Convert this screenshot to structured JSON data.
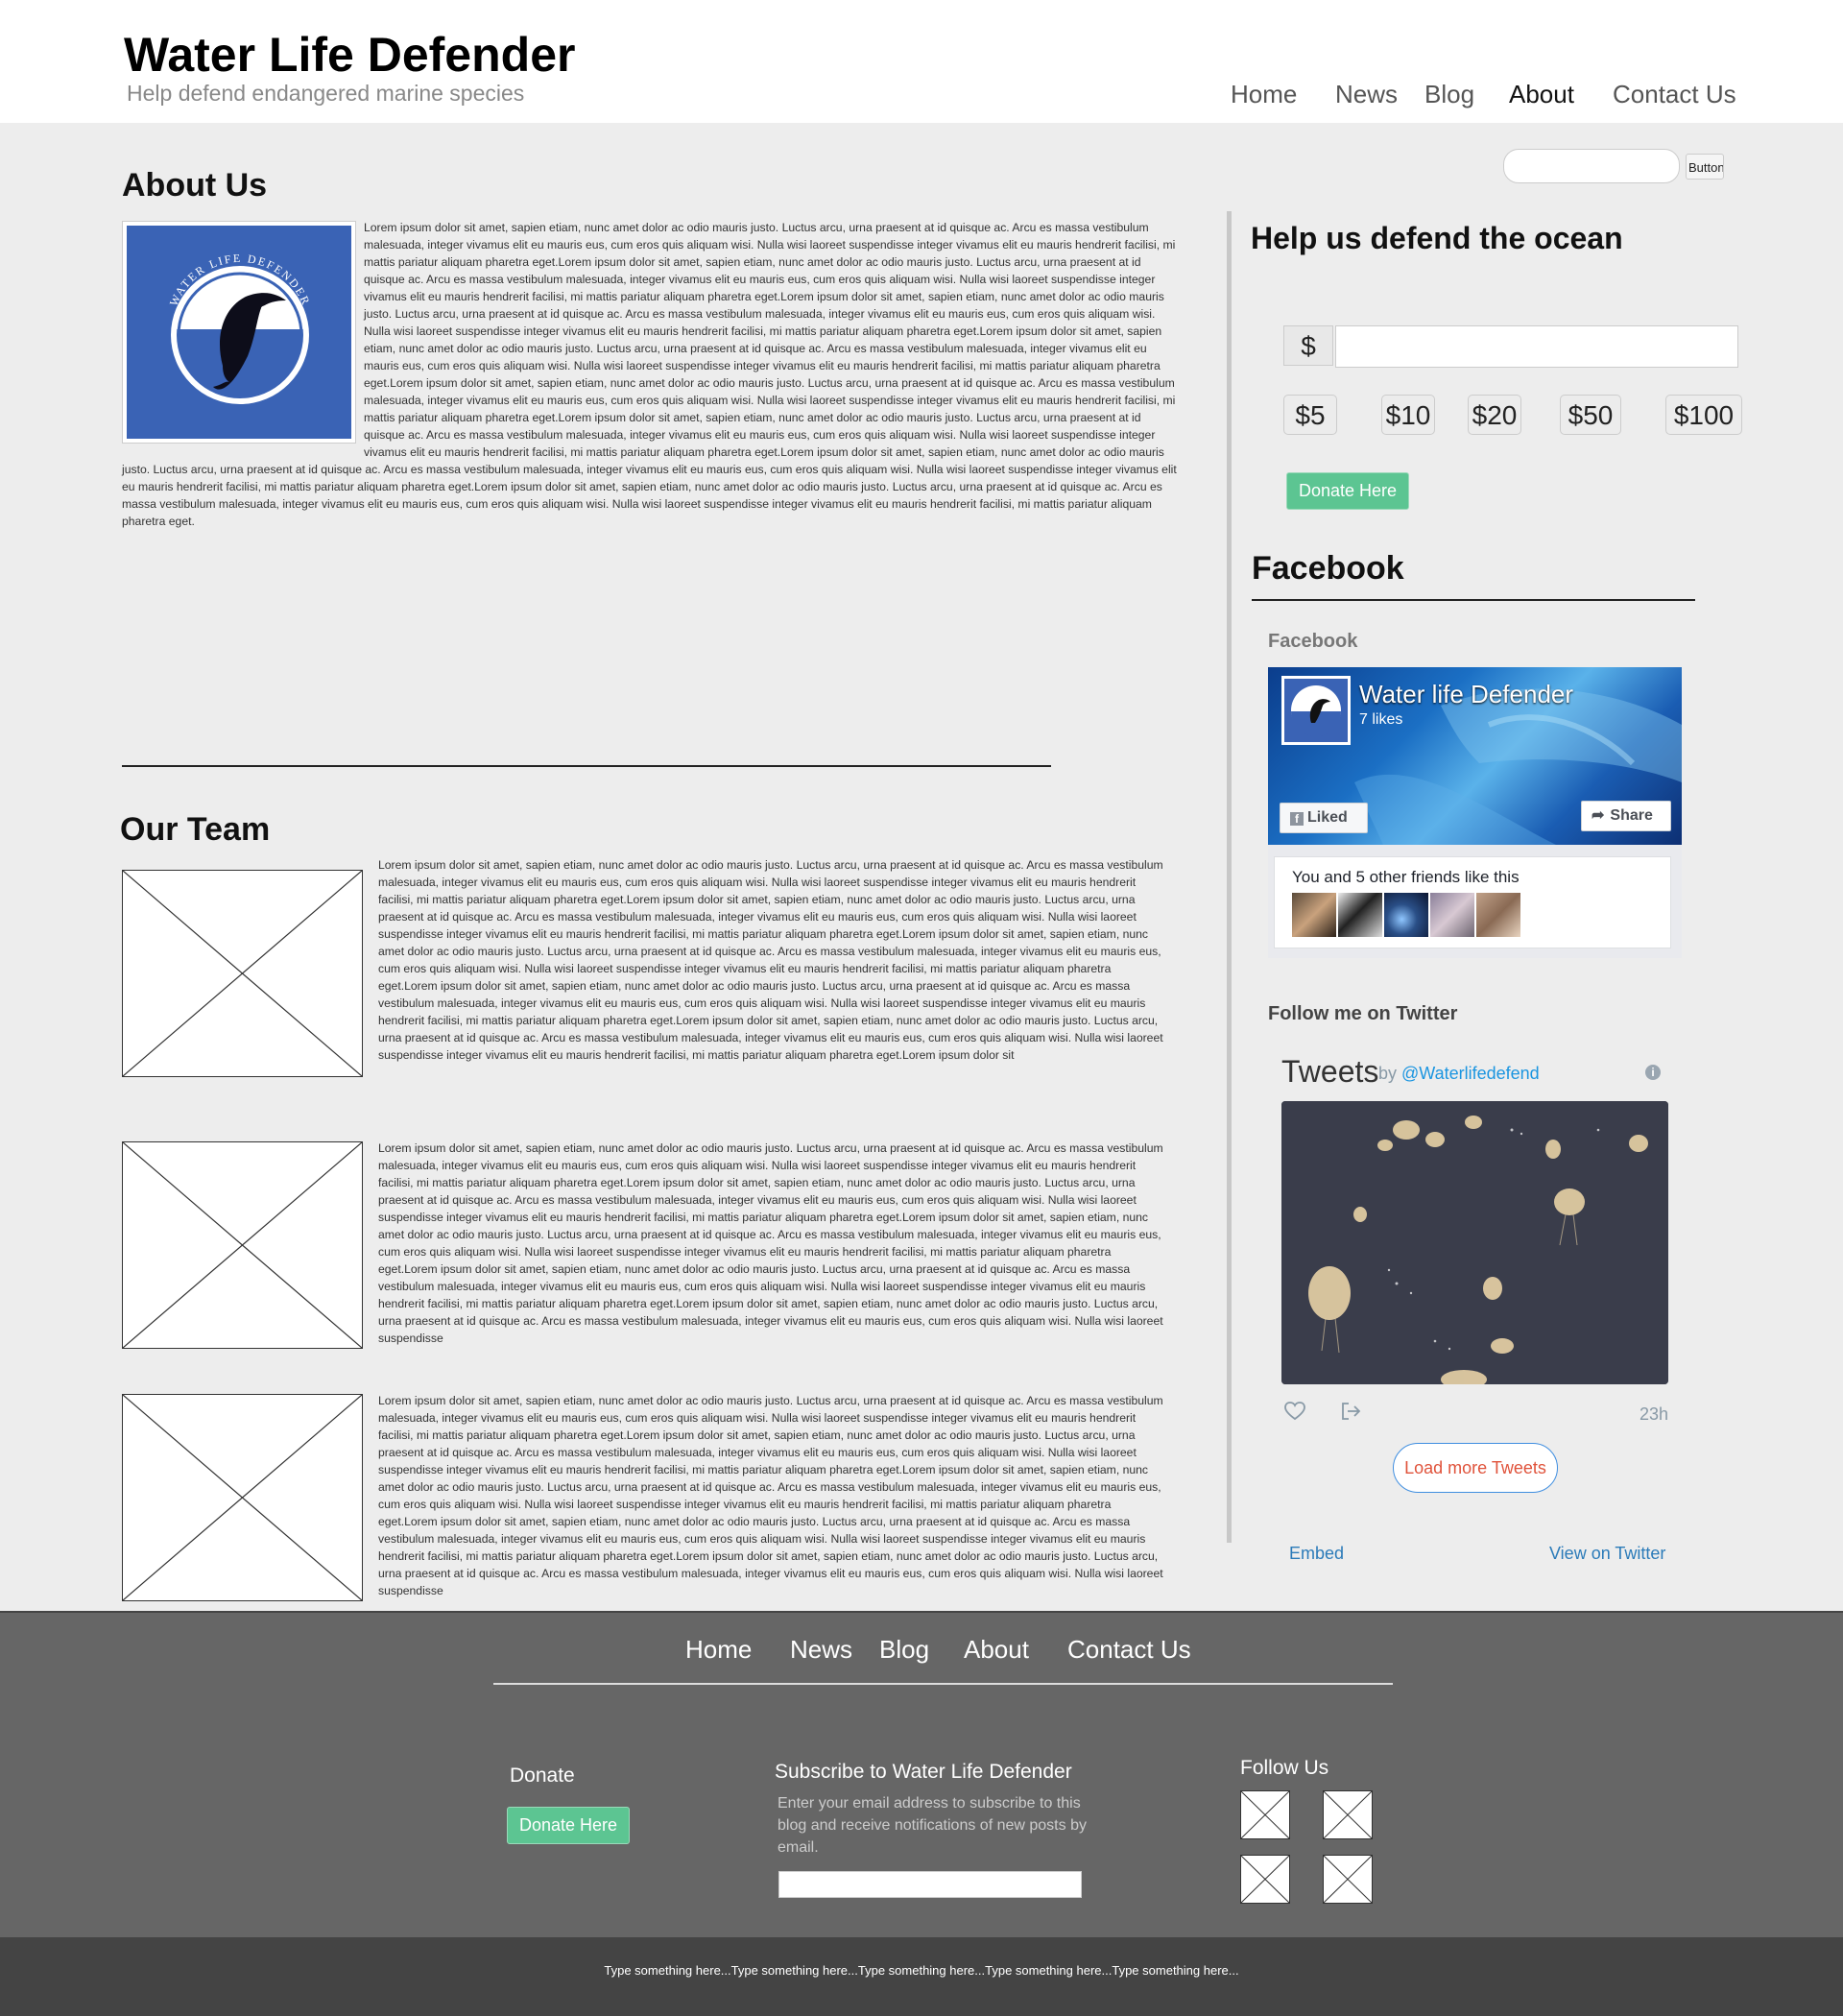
{
  "header": {
    "title": "Water Life Defender",
    "tagline": "Help defend endangered marine species",
    "nav": [
      "Home",
      "News",
      "Blog",
      "About",
      "Contact Us"
    ],
    "active_nav": "About"
  },
  "search": {
    "placeholder": "",
    "button_label": "Button"
  },
  "about": {
    "heading": "About Us",
    "logo_text": "WATER LIFE DEFENDER",
    "body": "Lorem ipsum dolor sit amet, sapien etiam, nunc amet dolor ac odio mauris justo. Luctus arcu, urna praesent at id quisque ac. Arcu es massa vestibulum malesuada, integer vivamus elit eu mauris eus, cum eros quis aliquam wisi. Nulla wisi laoreet suspendisse integer vivamus elit eu mauris hendrerit facilisi, mi mattis pariatur aliquam pharetra eget.Lorem ipsum dolor sit amet, sapien etiam, nunc amet dolor ac odio mauris justo. Luctus arcu, urna praesent at id quisque ac. Arcu es massa vestibulum malesuada, integer vivamus elit eu mauris eus, cum eros quis aliquam wisi. Nulla wisi laoreet suspendisse integer vivamus elit eu mauris hendrerit facilisi, mi mattis pariatur aliquam pharetra eget.Lorem ipsum dolor sit amet, sapien etiam, nunc amet dolor ac odio mauris justo. Luctus arcu, urna praesent at id quisque ac. Arcu es massa vestibulum malesuada, integer vivamus elit eu mauris eus, cum eros quis aliquam wisi. Nulla wisi laoreet suspendisse integer vivamus elit eu mauris hendrerit facilisi, mi mattis pariatur aliquam pharetra eget.Lorem ipsum dolor sit amet, sapien etiam, nunc amet dolor ac odio mauris justo. Luctus arcu, urna praesent at id quisque ac. Arcu es massa vestibulum malesuada, integer vivamus elit eu mauris eus, cum eros quis aliquam wisi. Nulla wisi laoreet suspendisse integer vivamus elit eu mauris hendrerit facilisi, mi mattis pariatur aliquam pharetra eget.Lorem ipsum dolor sit amet, sapien etiam, nunc amet dolor ac odio mauris justo. Luctus arcu, urna praesent at id quisque ac. Arcu es massa vestibulum malesuada, integer vivamus elit eu mauris eus, cum eros quis aliquam wisi. Nulla wisi laoreet suspendisse integer vivamus elit eu mauris hendrerit facilisi, mi mattis pariatur aliquam pharetra eget.Lorem ipsum dolor sit amet, sapien etiam, nunc amet dolor ac odio mauris justo. Luctus arcu, urna praesent at id quisque ac. Arcu es massa vestibulum malesuada, integer vivamus elit eu mauris eus, cum eros quis aliquam wisi. Nulla wisi laoreet suspendisse integer vivamus elit eu mauris hendrerit facilisi, mi mattis pariatur aliquam pharetra eget.Lorem ipsum dolor sit amet, sapien etiam, nunc amet dolor ac odio mauris justo. Luctus arcu, urna praesent at id quisque ac. Arcu es massa vestibulum malesuada, integer vivamus elit eu mauris eus, cum eros quis aliquam wisi. Nulla wisi laoreet suspendisse integer vivamus elit eu mauris hendrerit facilisi, mi mattis pariatur aliquam pharetra eget.Lorem ipsum dolor sit amet, sapien etiam, nunc amet dolor ac odio mauris justo. Luctus arcu, urna praesent at id quisque ac. Arcu es massa vestibulum malesuada, integer vivamus elit eu mauris eus, cum eros quis aliquam wisi. Nulla wisi laoreet suspendisse integer vivamus elit eu mauris hendrerit facilisi, mi mattis pariatur aliquam pharetra eget."
  },
  "team": {
    "heading": "Our Team",
    "members": [
      {
        "bio": "Lorem ipsum dolor sit amet, sapien etiam, nunc amet dolor ac odio mauris justo. Luctus arcu, urna praesent at id quisque ac. Arcu es massa vestibulum malesuada, integer vivamus elit eu mauris eus, cum eros quis aliquam wisi. Nulla wisi laoreet suspendisse integer vivamus elit eu mauris hendrerit facilisi, mi mattis pariatur aliquam pharetra eget.Lorem ipsum dolor sit amet, sapien etiam, nunc amet dolor ac odio mauris justo. Luctus arcu, urna praesent at id quisque ac. Arcu es massa vestibulum malesuada, integer vivamus elit eu mauris eus, cum eros quis aliquam wisi. Nulla wisi laoreet suspendisse integer vivamus elit eu mauris hendrerit facilisi, mi mattis pariatur aliquam pharetra eget.Lorem ipsum dolor sit amet, sapien etiam, nunc amet dolor ac odio mauris justo. Luctus arcu, urna praesent at id quisque ac. Arcu es massa vestibulum malesuada, integer vivamus elit eu mauris eus, cum eros quis aliquam wisi. Nulla wisi laoreet suspendisse integer vivamus elit eu mauris hendrerit facilisi, mi mattis pariatur aliquam pharetra eget.Lorem ipsum dolor sit amet, sapien etiam, nunc amet dolor ac odio mauris justo. Luctus arcu, urna praesent at id quisque ac. Arcu es massa vestibulum malesuada, integer vivamus elit eu mauris eus, cum eros quis aliquam wisi. Nulla wisi laoreet suspendisse integer vivamus elit eu mauris hendrerit facilisi, mi mattis pariatur aliquam pharetra eget.Lorem ipsum dolor sit amet, sapien etiam, nunc amet dolor ac odio mauris justo. Luctus arcu, urna praesent at id quisque ac. Arcu es massa vestibulum malesuada, integer vivamus elit eu mauris eus, cum eros quis aliquam wisi. Nulla wisi laoreet suspendisse integer vivamus elit eu mauris hendrerit facilisi, mi mattis pariatur aliquam pharetra eget.Lorem ipsum dolor sit"
      },
      {
        "bio": "Lorem ipsum dolor sit amet, sapien etiam, nunc amet dolor ac odio mauris justo. Luctus arcu, urna praesent at id quisque ac. Arcu es massa vestibulum malesuada, integer vivamus elit eu mauris eus, cum eros quis aliquam wisi. Nulla wisi laoreet suspendisse integer vivamus elit eu mauris hendrerit facilisi, mi mattis pariatur aliquam pharetra eget.Lorem ipsum dolor sit amet, sapien etiam, nunc amet dolor ac odio mauris justo. Luctus arcu, urna praesent at id quisque ac. Arcu es massa vestibulum malesuada, integer vivamus elit eu mauris eus, cum eros quis aliquam wisi. Nulla wisi laoreet suspendisse integer vivamus elit eu mauris hendrerit facilisi, mi mattis pariatur aliquam pharetra eget.Lorem ipsum dolor sit amet, sapien etiam, nunc amet dolor ac odio mauris justo. Luctus arcu, urna praesent at id quisque ac. Arcu es massa vestibulum malesuada, integer vivamus elit eu mauris eus, cum eros quis aliquam wisi. Nulla wisi laoreet suspendisse integer vivamus elit eu mauris hendrerit facilisi, mi mattis pariatur aliquam pharetra eget.Lorem ipsum dolor sit amet, sapien etiam, nunc amet dolor ac odio mauris justo. Luctus arcu, urna praesent at id quisque ac. Arcu es massa vestibulum malesuada, integer vivamus elit eu mauris eus, cum eros quis aliquam wisi. Nulla wisi laoreet suspendisse integer vivamus elit eu mauris hendrerit facilisi, mi mattis pariatur aliquam pharetra eget.Lorem ipsum dolor sit amet, sapien etiam, nunc amet dolor ac odio mauris justo. Luctus arcu, urna praesent at id quisque ac. Arcu es massa vestibulum malesuada, integer vivamus elit eu mauris eus, cum eros quis aliquam wisi. Nulla wisi laoreet suspendisse"
      },
      {
        "bio": "Lorem ipsum dolor sit amet, sapien etiam, nunc amet dolor ac odio mauris justo. Luctus arcu, urna praesent at id quisque ac. Arcu es massa vestibulum malesuada, integer vivamus elit eu mauris eus, cum eros quis aliquam wisi. Nulla wisi laoreet suspendisse integer vivamus elit eu mauris hendrerit facilisi, mi mattis pariatur aliquam pharetra eget.Lorem ipsum dolor sit amet, sapien etiam, nunc amet dolor ac odio mauris justo. Luctus arcu, urna praesent at id quisque ac. Arcu es massa vestibulum malesuada, integer vivamus elit eu mauris eus, cum eros quis aliquam wisi. Nulla wisi laoreet suspendisse integer vivamus elit eu mauris hendrerit facilisi, mi mattis pariatur aliquam pharetra eget.Lorem ipsum dolor sit amet, sapien etiam, nunc amet dolor ac odio mauris justo. Luctus arcu, urna praesent at id quisque ac. Arcu es massa vestibulum malesuada, integer vivamus elit eu mauris eus, cum eros quis aliquam wisi. Nulla wisi laoreet suspendisse integer vivamus elit eu mauris hendrerit facilisi, mi mattis pariatur aliquam pharetra eget.Lorem ipsum dolor sit amet, sapien etiam, nunc amet dolor ac odio mauris justo. Luctus arcu, urna praesent at id quisque ac. Arcu es massa vestibulum malesuada, integer vivamus elit eu mauris eus, cum eros quis aliquam wisi. Nulla wisi laoreet suspendisse integer vivamus elit eu mauris hendrerit facilisi, mi mattis pariatur aliquam pharetra eget.Lorem ipsum dolor sit amet, sapien etiam, nunc amet dolor ac odio mauris justo. Luctus arcu, urna praesent at id quisque ac. Arcu es massa vestibulum malesuada, integer vivamus elit eu mauris eus, cum eros quis aliquam wisi. Nulla wisi laoreet suspendisse"
      }
    ]
  },
  "donate": {
    "heading": "Help us defend the ocean",
    "currency": "$",
    "amounts": [
      "$5",
      "$10",
      "$20",
      "$50",
      "$100"
    ],
    "button_label": "Donate Here"
  },
  "facebook": {
    "heading": "Facebook",
    "label": "Facebook",
    "page_name": "Water life Defender",
    "likes": "7 likes",
    "liked_label": "Liked",
    "share_label": "Share",
    "friends_text": "You and 5 other friends like this"
  },
  "twitter": {
    "label": "Follow me on Twitter",
    "title": "Tweets",
    "by": "by",
    "handle": "@Waterlifedefend",
    "time": "23h",
    "load_more": "Load more Tweets",
    "embed": "Embed",
    "view_on": "View on Twitter"
  },
  "footer": {
    "nav": [
      "Home",
      "News",
      "Blog",
      "About",
      "Contact Us"
    ],
    "donate_title": "Donate",
    "donate_button": "Donate Here",
    "subscribe_title": "Subscribe to Water Life Defender",
    "subscribe_text": "Enter your email address to subscribe to this blog and receive notifications of new posts by email.",
    "follow_title": "Follow Us",
    "bottom_text": "Type something here...Type something here...Type something here...Type something here...Type something here..."
  },
  "colors": {
    "accent_green": "#5cc592",
    "logo_blue": "#3a63b5",
    "footer_bg": "#666666",
    "subfooter_bg": "#444444"
  }
}
